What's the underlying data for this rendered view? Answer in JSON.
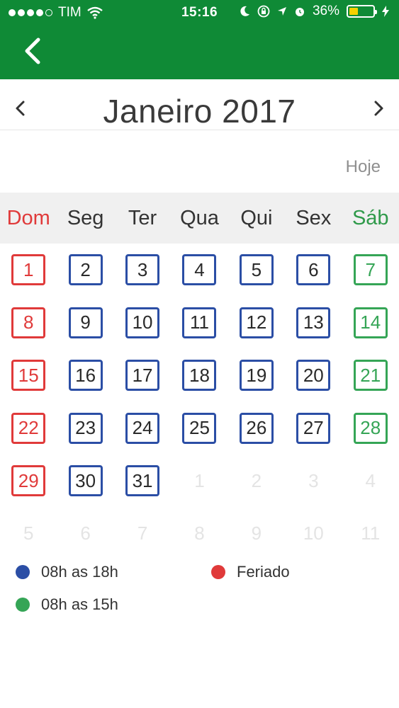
{
  "status_bar": {
    "carrier": "TIM",
    "time": "15:16",
    "battery": "36%",
    "battery_level": 0.36
  },
  "header": {
    "back_icon": "chevron-left-icon",
    "color": "#0f8a36"
  },
  "month_nav": {
    "title": "Janeiro 2017",
    "prev_icon": "chevron-left-icon",
    "next_icon": "chevron-right-icon"
  },
  "today_button": "Hoje",
  "weekdays": [
    "Dom",
    "Seg",
    "Ter",
    "Qua",
    "Qui",
    "Sex",
    "Sáb"
  ],
  "weeks": [
    [
      {
        "d": "1",
        "t": "holiday"
      },
      {
        "d": "2",
        "t": "weekday"
      },
      {
        "d": "3",
        "t": "weekday"
      },
      {
        "d": "4",
        "t": "weekday"
      },
      {
        "d": "5",
        "t": "weekday"
      },
      {
        "d": "6",
        "t": "weekday"
      },
      {
        "d": "7",
        "t": "saturday"
      }
    ],
    [
      {
        "d": "8",
        "t": "holiday"
      },
      {
        "d": "9",
        "t": "weekday"
      },
      {
        "d": "10",
        "t": "weekday"
      },
      {
        "d": "11",
        "t": "weekday"
      },
      {
        "d": "12",
        "t": "weekday"
      },
      {
        "d": "13",
        "t": "weekday"
      },
      {
        "d": "14",
        "t": "saturday"
      }
    ],
    [
      {
        "d": "15",
        "t": "holiday"
      },
      {
        "d": "16",
        "t": "weekday"
      },
      {
        "d": "17",
        "t": "weekday"
      },
      {
        "d": "18",
        "t": "weekday"
      },
      {
        "d": "19",
        "t": "weekday"
      },
      {
        "d": "20",
        "t": "weekday"
      },
      {
        "d": "21",
        "t": "saturday"
      }
    ],
    [
      {
        "d": "22",
        "t": "holiday"
      },
      {
        "d": "23",
        "t": "weekday"
      },
      {
        "d": "24",
        "t": "weekday"
      },
      {
        "d": "25",
        "t": "weekday"
      },
      {
        "d": "26",
        "t": "weekday"
      },
      {
        "d": "27",
        "t": "weekday"
      },
      {
        "d": "28",
        "t": "saturday"
      }
    ],
    [
      {
        "d": "29",
        "t": "holiday"
      },
      {
        "d": "30",
        "t": "weekday"
      },
      {
        "d": "31",
        "t": "weekday"
      },
      {
        "d": "1",
        "t": "other"
      },
      {
        "d": "2",
        "t": "other"
      },
      {
        "d": "3",
        "t": "other"
      },
      {
        "d": "4",
        "t": "other"
      }
    ],
    [
      {
        "d": "5",
        "t": "other"
      },
      {
        "d": "6",
        "t": "other"
      },
      {
        "d": "7",
        "t": "other"
      },
      {
        "d": "8",
        "t": "other"
      },
      {
        "d": "9",
        "t": "other"
      },
      {
        "d": "10",
        "t": "other"
      },
      {
        "d": "11",
        "t": "other"
      }
    ]
  ],
  "legend": [
    {
      "label": "08h as 18h",
      "color": "#2b4ea5"
    },
    {
      "label": "Feriado",
      "color": "#e03a3a"
    },
    {
      "label": "08h as 15h",
      "color": "#35a556"
    }
  ],
  "colors": {
    "weekday": "#2b4ea5",
    "holiday": "#e03a3a",
    "saturday": "#35a556"
  }
}
